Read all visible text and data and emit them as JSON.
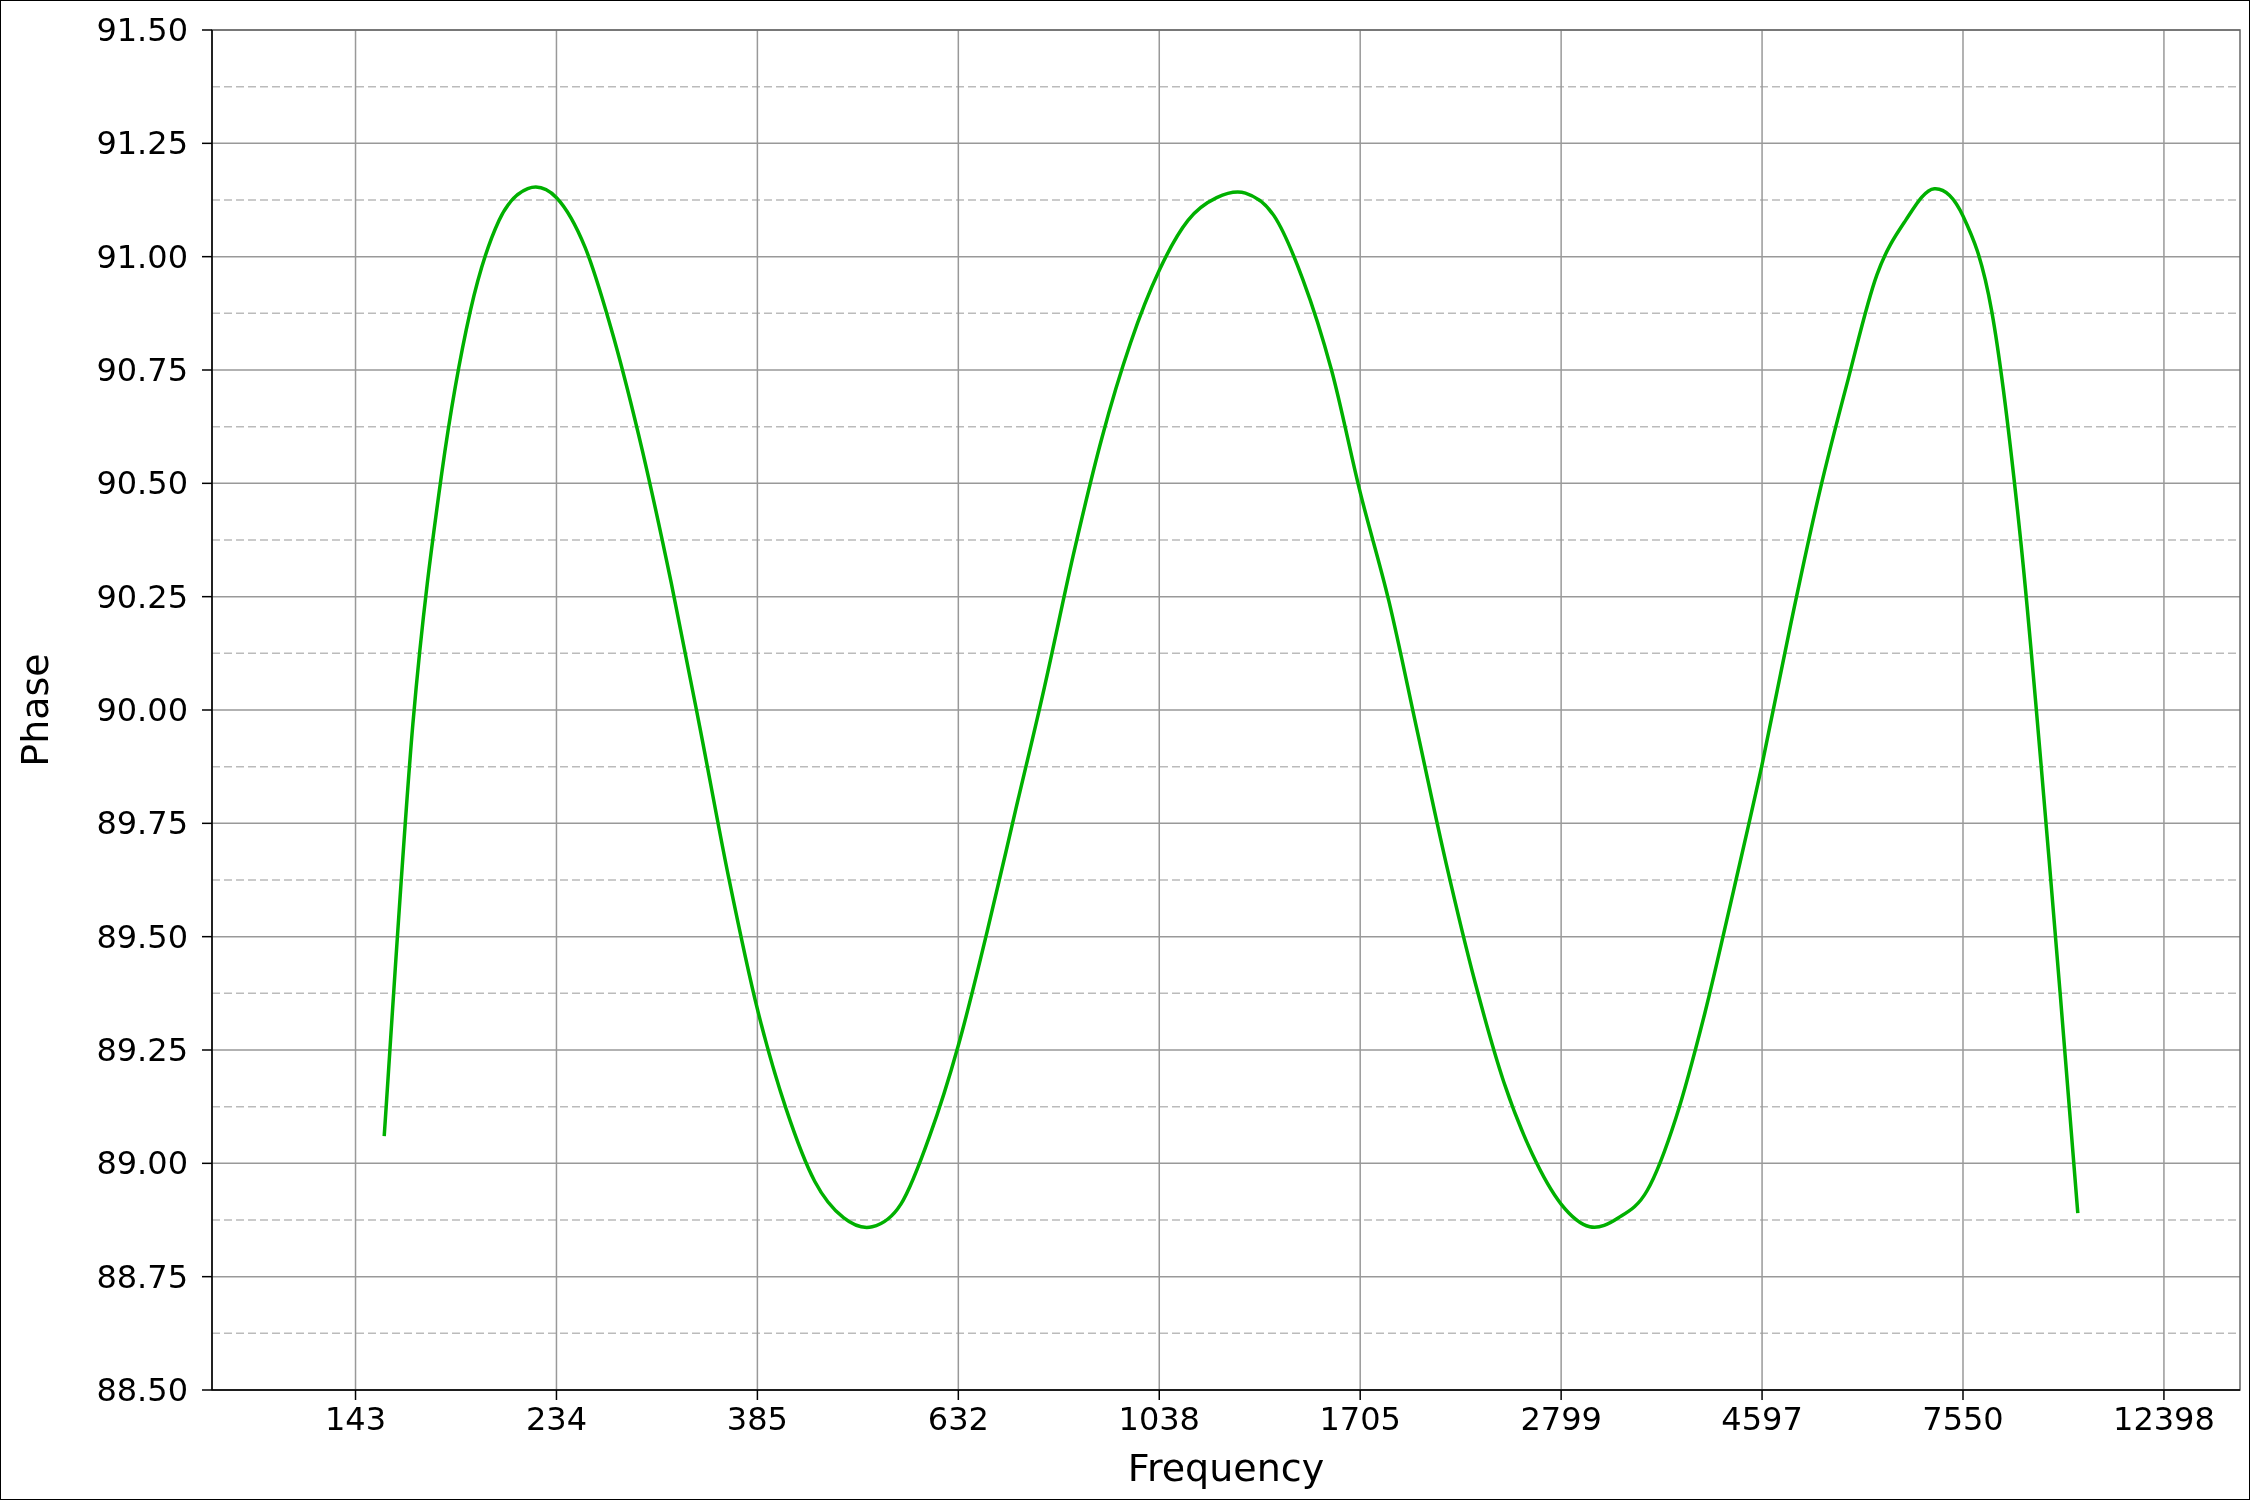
{
  "chart_data": {
    "type": "line",
    "grid": true,
    "xlabel": "Frequency",
    "ylabel": "Phase",
    "ylim": [
      88.5,
      91.5
    ],
    "categories": [
      null,
      null,
      null,
      null,
      null,
      "143",
      null,
      null,
      null,
      null,
      null,
      null,
      "234",
      null,
      null,
      null,
      null,
      null,
      null,
      "385",
      null,
      null,
      null,
      null,
      null,
      null,
      "632",
      null,
      null,
      null,
      null,
      null,
      null,
      "1038",
      null,
      null,
      null,
      null,
      null,
      null,
      "1705",
      null,
      null,
      null,
      null,
      null,
      null,
      "2799",
      null,
      null,
      null,
      null,
      null,
      null,
      "4597",
      null,
      null,
      null,
      null,
      null,
      null,
      "7550",
      null,
      null,
      null,
      null,
      null,
      null,
      "12398",
      null,
      null
    ],
    "yticks": [
      {
        "value": 88.5,
        "label": "88.50"
      },
      {
        "value": 88.75,
        "label": "88.75"
      },
      {
        "value": 89,
        "label": "89.00"
      },
      {
        "value": 89.25,
        "label": "89.25"
      },
      {
        "value": 89.5,
        "label": "89.50"
      },
      {
        "value": 89.75,
        "label": "89.75"
      },
      {
        "value": 90,
        "label": "90.00"
      },
      {
        "value": 90.25,
        "label": "90.25"
      },
      {
        "value": 90.5,
        "label": "90.50"
      },
      {
        "value": 90.75,
        "label": "90.75"
      },
      {
        "value": 91,
        "label": "91.00"
      },
      {
        "value": 91.25,
        "label": "91.25"
      },
      {
        "value": 91.5,
        "label": "91.50"
      }
    ],
    "series": [
      {
        "color": "#00b000",
        "values": [
          null,
          null,
          null,
          null,
          null,
          null,
          89.06,
          89.97,
          90.52,
          90.88,
          91.08,
          91.15,
          91.13,
          91.02,
          90.82,
          90.57,
          90.28,
          89.96,
          89.63,
          89.34,
          89.12,
          88.96,
          88.88,
          88.86,
          88.91,
          89.06,
          89.26,
          89.51,
          89.78,
          90.05,
          90.34,
          90.6,
          90.81,
          90.97,
          91.08,
          91.13,
          91.14,
          91.09,
          90.95,
          90.75,
          90.48,
          90.24,
          89.95,
          89.66,
          89.4,
          89.18,
          89.02,
          88.91,
          88.86,
          88.88,
          88.94,
          89.1,
          89.33,
          89.6,
          89.88,
          90.19,
          90.48,
          90.73,
          90.96,
          91.08,
          91.15,
          91.09,
          90.88,
          90.38,
          89.67,
          88.89,
          null,
          null,
          null,
          null,
          null
        ]
      }
    ]
  }
}
